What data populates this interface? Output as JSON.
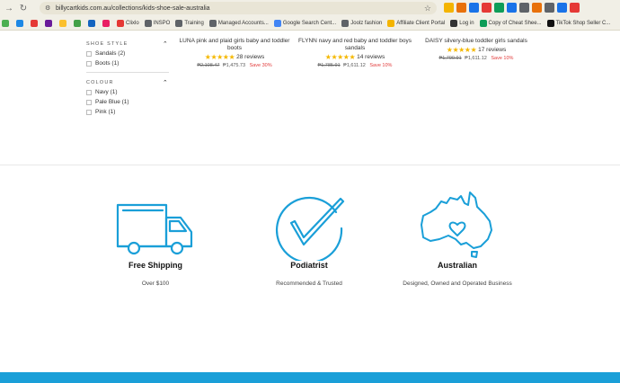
{
  "browser": {
    "url": "billycartkids.com.au/collections/kids-shoe-sale-australia",
    "bookmarks": [
      {
        "label": "",
        "color": "#4caf50"
      },
      {
        "label": "",
        "color": "#1e88e5"
      },
      {
        "label": "",
        "color": "#e53935"
      },
      {
        "label": "",
        "color": "#6a1b9a"
      },
      {
        "label": "",
        "color": "#fbc02d"
      },
      {
        "label": "",
        "color": "#43a047"
      },
      {
        "label": "",
        "color": "#1565c0"
      },
      {
        "label": "",
        "color": "#e91e63"
      },
      {
        "label": "Clixlo",
        "color": "#e53935"
      },
      {
        "label": "INSPO",
        "color": "#5f6368"
      },
      {
        "label": "Training",
        "color": "#5f6368"
      },
      {
        "label": "Managed Accounts...",
        "color": "#5f6368"
      },
      {
        "label": "Google Search Cent...",
        "color": "#4285f4"
      },
      {
        "label": "Joolz fashion",
        "color": "#5f6368"
      },
      {
        "label": "Affiliate Client Portal",
        "color": "#f4b400"
      },
      {
        "label": "Log in",
        "color": "#333333"
      },
      {
        "label": "Copy of Cheat Shee...",
        "color": "#0f9d58"
      },
      {
        "label": "TikTok Shop Seller C...",
        "color": "#111111"
      }
    ],
    "extension_colors": [
      "#f4b400",
      "#e8710a",
      "#1a73e8",
      "#e53935",
      "#0f9d58",
      "#1a73e8",
      "#5f6368",
      "#e8710a",
      "#5f6368",
      "#1a73e8",
      "#e53935"
    ]
  },
  "filters": [
    {
      "heading": "SHOE STYLE",
      "items": [
        "Sandals (2)",
        "Boots (1)"
      ]
    },
    {
      "heading": "COLOUR",
      "items": [
        "Navy (1)",
        "Pale Blue (1)",
        "Pink (1)"
      ]
    }
  ],
  "products": [
    {
      "name": "LUNA pink and plaid girls baby and toddler boots",
      "reviews": "28 reviews",
      "old_price": "₱2,108.47",
      "new_price": "₱1,475.73",
      "save": "Save 30%"
    },
    {
      "name": "FLYNN navy and red baby and toddler boys sandals",
      "reviews": "14 reviews",
      "old_price": "₱1,785.91",
      "new_price": "₱1,611.12",
      "save": "Save 10%"
    },
    {
      "name": "DAISY silvery-blue toddler girls sandals",
      "reviews": "17 reviews",
      "old_price": "₱1,790.91",
      "new_price": "₱1,611.12",
      "save": "Save 10%"
    }
  ],
  "features": [
    {
      "icon": "delivery-truck-icon",
      "title": "Free Shipping",
      "subtitle": "Over $100"
    },
    {
      "icon": "checkmark-circle-icon",
      "title": "Podiatrist",
      "subtitle": "Recommended & Trusted"
    },
    {
      "icon": "australia-heart-icon",
      "title": "Australian",
      "subtitle": "Designed, Owned and Operated Business"
    }
  ],
  "colors": {
    "accent": "#1a9fd8",
    "star": "#f5b800",
    "save": "#e23b3b"
  }
}
